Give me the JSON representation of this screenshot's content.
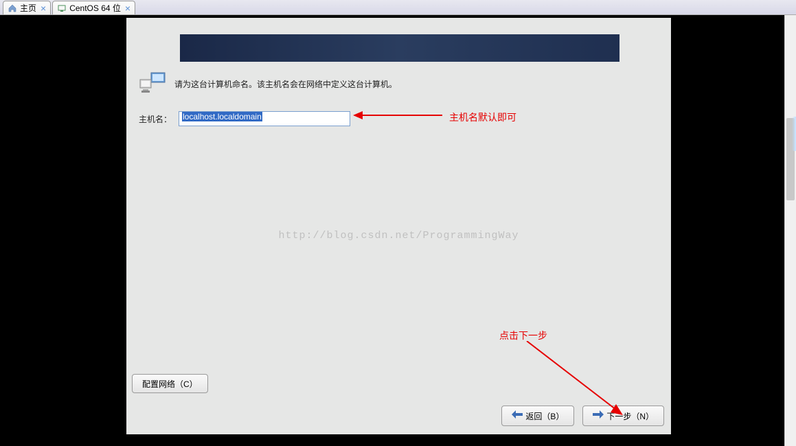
{
  "tabs": {
    "home": {
      "label": "主页"
    },
    "centos": {
      "label": "CentOS 64 位"
    }
  },
  "installer": {
    "intro": "请为这台计算机命名。该主机名会在网络中定义这台计算机。",
    "hostname_label": "主机名：",
    "hostname_value": "localhost.localdomain",
    "config_network_label": "配置网络（C）",
    "back_label": "返回（B）",
    "next_label": "下一步（N）"
  },
  "annotations": {
    "hostname_note": "主机名默认即可",
    "next_note": "点击下一步"
  },
  "watermark": "http://blog.csdn.net/ProgrammingWay"
}
